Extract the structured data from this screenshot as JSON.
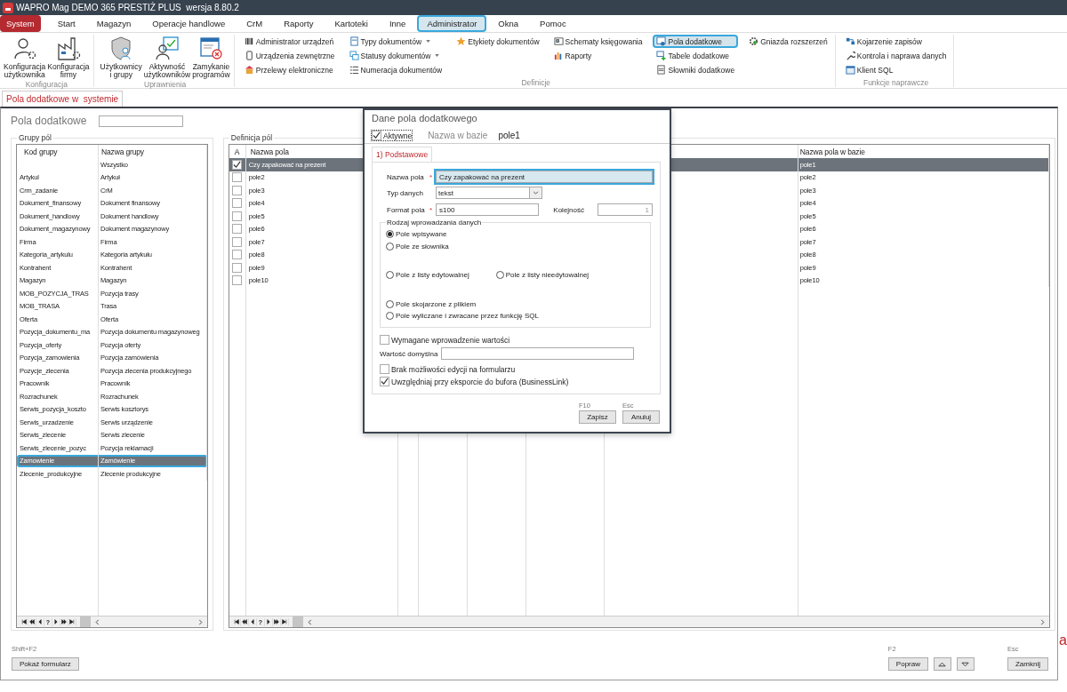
{
  "window": {
    "title": "WAPRO Mag DEMO 365 PRESTIŻ PLUS  wersja 8.80.2"
  },
  "menu_tabs": [
    {
      "label": "System",
      "kind": "app",
      "selected": false,
      "highlighted": false
    },
    {
      "label": "Start",
      "kind": "tab",
      "selected": false,
      "highlighted": false
    },
    {
      "label": "Magazyn",
      "kind": "tab",
      "selected": false,
      "highlighted": false
    },
    {
      "label": "Operacje handlowe",
      "kind": "tab",
      "selected": false,
      "highlighted": false
    },
    {
      "label": "CrM",
      "kind": "tab",
      "selected": false,
      "highlighted": false
    },
    {
      "label": "Raporty",
      "kind": "tab",
      "selected": false,
      "highlighted": false
    },
    {
      "label": "Kartoteki",
      "kind": "tab",
      "selected": false,
      "highlighted": false
    },
    {
      "label": "Inne",
      "kind": "tab",
      "selected": false,
      "highlighted": false
    },
    {
      "label": "Administrator",
      "kind": "tab",
      "selected": true,
      "highlighted": true
    },
    {
      "label": "Okna",
      "kind": "tab",
      "selected": false,
      "highlighted": false
    },
    {
      "label": "Pomoc",
      "kind": "tab",
      "selected": false,
      "highlighted": false
    }
  ],
  "ribbon": [
    {
      "label": "Konfiguracja",
      "kind": "large",
      "items": [
        {
          "label": "Konfiguracja\nużytkownika"
        },
        {
          "label": "Konfiguracja\nfirmy"
        }
      ]
    },
    {
      "label": "Uprawnienia",
      "kind": "large",
      "items": [
        {
          "label": "Użytkownicy\ni grupy"
        },
        {
          "label": "Aktywność\nużytkowników"
        },
        {
          "label": "Zamykanie\nprogramów"
        }
      ]
    },
    {
      "label": "Definicje",
      "kind": "small",
      "columns": [
        [
          {
            "label": "Administrator urządzeń",
            "has_menu": false,
            "highlighted": false
          },
          {
            "label": "Urządzenia zewnętrzne",
            "has_menu": false,
            "highlighted": false
          },
          {
            "label": "Przelewy elektroniczne",
            "has_menu": false,
            "highlighted": false
          }
        ],
        [
          {
            "label": "Typy dokumentów",
            "has_menu": true,
            "highlighted": false
          },
          {
            "label": "Statusy dokumentów",
            "has_menu": true,
            "highlighted": false
          },
          {
            "label": "Numeracja dokumentów",
            "has_menu": false,
            "highlighted": false
          }
        ],
        [
          {
            "label": "Etykiety dokumentów",
            "has_menu": false,
            "highlighted": false
          }
        ],
        [
          {
            "label": "Schematy księgowania",
            "has_menu": false,
            "highlighted": false
          },
          {
            "label": "Raporty",
            "has_menu": false,
            "highlighted": false
          }
        ],
        [
          {
            "label": "Pola dodatkowe",
            "has_menu": false,
            "highlighted": true
          },
          {
            "label": "Tabele dodatkowe",
            "has_menu": false,
            "highlighted": false
          },
          {
            "label": "Słowniki dodatkowe",
            "has_menu": false,
            "highlighted": false
          }
        ],
        [
          {
            "label": "Gniazda rozszerzeń",
            "has_menu": false,
            "highlighted": false
          }
        ]
      ]
    },
    {
      "label": "Funkcje naprawcze",
      "kind": "small",
      "columns": [
        [
          {
            "label": "Kojarzenie zapisów",
            "has_menu": false,
            "highlighted": false
          },
          {
            "label": "Kontrola i naprawa danych",
            "has_menu": false,
            "highlighted": false
          },
          {
            "label": "Klient SQL",
            "has_menu": false,
            "highlighted": false
          }
        ]
      ]
    }
  ],
  "document_tab": {
    "label": "Pola dodatkowe w  systemie"
  },
  "page_title": "Pola dodatkowe",
  "groups_panel": {
    "title": "Grupy pól",
    "columns": [
      "Kod grupy",
      "Nazwa grupy"
    ],
    "nav_help": "?",
    "rows": [
      {
        "name": "Wszystko",
        "selected": false,
        "highlighted": false
      },
      {
        "code": "Artykul",
        "name": "Artykuł",
        "selected": false,
        "highlighted": false
      },
      {
        "code": "Crm_zadanie",
        "name": "CrM",
        "selected": false,
        "highlighted": false
      },
      {
        "code": "Dokument_finansowy",
        "name": "Dokument finansowy",
        "selected": false,
        "highlighted": false
      },
      {
        "code": "Dokument_handlowy",
        "name": "Dokument handlowy",
        "selected": false,
        "highlighted": false
      },
      {
        "code": "Dokument_magazynowy",
        "name": "Dokument magazynowy",
        "selected": false,
        "highlighted": false
      },
      {
        "code": "Firma",
        "name": "Firma",
        "selected": false,
        "highlighted": false
      },
      {
        "code": "Kategoria_artykulu",
        "name": "Kategoria artykułu",
        "selected": false,
        "highlighted": false
      },
      {
        "code": "Kontrahent",
        "name": "Kontrahent",
        "selected": false,
        "highlighted": false
      },
      {
        "code": "Magazyn",
        "name": "Magazyn",
        "selected": false,
        "highlighted": false
      },
      {
        "code": "MOB_POZYCJA_TRAS",
        "name": "Pozycja trasy",
        "selected": false,
        "highlighted": false
      },
      {
        "code": "MOB_TRASA",
        "name": "Trasa",
        "selected": false,
        "highlighted": false
      },
      {
        "code": "Oferta",
        "name": "Oferta",
        "selected": false,
        "highlighted": false
      },
      {
        "code": "Pozycja_dokumentu_ma",
        "name": "Pozycja dokumentu magazynoweg",
        "selected": false,
        "highlighted": false
      },
      {
        "code": "Pozycja_oferty",
        "name": "Pozycja oferty",
        "selected": false,
        "highlighted": false
      },
      {
        "code": "Pozycja_zamowienia",
        "name": "Pozycja zamówienia",
        "selected": false,
        "highlighted": false
      },
      {
        "code": "Pozycje_zlecenia",
        "name": "Pozycja zlecenia produkcyjnego",
        "selected": false,
        "highlighted": false
      },
      {
        "code": "Pracownik",
        "name": "Pracownik",
        "selected": false,
        "highlighted": false
      },
      {
        "code": "Rozrachunek",
        "name": "Rozrachunek",
        "selected": false,
        "highlighted": false
      },
      {
        "code": "Serwis_pozycja_koszto",
        "name": "Serwis kosztorys",
        "selected": false,
        "highlighted": false
      },
      {
        "code": "Serwis_urzadzenie",
        "name": "Serwis urządzenie",
        "selected": false,
        "highlighted": false
      },
      {
        "code": "Serwis_zlecenie",
        "name": "Serwis zlecenie",
        "selected": false,
        "highlighted": false
      },
      {
        "code": "Serwis_zlecenie_pozyc",
        "name": "Pozycja reklamacji",
        "selected": false,
        "highlighted": false
      },
      {
        "code": "Zamowienie",
        "name": "Zamówienie",
        "selected": true,
        "highlighted": true
      },
      {
        "code": "Zlecenie_produkcyjne",
        "name": "Zlecenie produkcyjne",
        "selected": false,
        "highlighted": false
      }
    ]
  },
  "fields_panel": {
    "title": "Definicja pól",
    "columns": [
      "A",
      "Nazwa pola",
      "Nazwa pola w bazie"
    ],
    "nav_help": "?",
    "rows": [
      {
        "active": true,
        "name": "Czy zapakować na prezent",
        "db_name": "pole1",
        "selected": true
      },
      {
        "active": false,
        "name": "pole2",
        "db_name": "pole2",
        "selected": false
      },
      {
        "active": false,
        "name": "pole3",
        "db_name": "pole3",
        "selected": false
      },
      {
        "active": false,
        "name": "pole4",
        "db_name": "pole4",
        "selected": false
      },
      {
        "active": false,
        "name": "pole5",
        "db_name": "pole5",
        "selected": false
      },
      {
        "active": false,
        "name": "pole6",
        "db_name": "pole6",
        "selected": false
      },
      {
        "active": false,
        "name": "pole7",
        "db_name": "pole7",
        "selected": false
      },
      {
        "active": false,
        "name": "pole8",
        "db_name": "pole8",
        "selected": false
      },
      {
        "active": false,
        "name": "pole9",
        "db_name": "pole9",
        "selected": false
      },
      {
        "active": false,
        "name": "pole10",
        "db_name": "pole10",
        "selected": false
      }
    ]
  },
  "footer": {
    "show_form": {
      "shortcut": "Shift+F2",
      "label": "Pokaż formularz"
    },
    "edit": {
      "shortcut": "F2",
      "label": "Popraw"
    },
    "close": {
      "shortcut": "Esc",
      "label": "Zamknij"
    }
  },
  "edge_mark": "a",
  "dialog": {
    "title": "Dane pola dodatkowego",
    "active": {
      "label": "Aktywne",
      "checked": true
    },
    "db_name_label": "Nazwa w bazie",
    "db_name": "pole1",
    "tab": {
      "label": "1) Podstawowe",
      "selected": true
    },
    "name_field": {
      "label": "Nazwa pola",
      "value": "Czy zapakować na prezent",
      "required_mark": "*",
      "highlighted": true
    },
    "type_field": {
      "label": "Typ danych",
      "value": "tekst"
    },
    "format_field": {
      "label": "Format pola",
      "value": "s100",
      "required_mark": "*"
    },
    "order_field": {
      "label": "Kolejność",
      "value": "1",
      "disabled": true
    },
    "input_mode": {
      "title": "Rodzaj wprowadzania danych",
      "options": [
        {
          "label": "Pole wpisywane",
          "selected": true
        },
        {
          "label": "Pole ze słownika",
          "selected": false
        },
        {
          "label": "Pole z listy edytowalnej",
          "selected": false
        },
        {
          "label": "Pole z listy nieedytowalnej",
          "selected": false
        },
        {
          "label": "Pole skojarzone z plikiem",
          "selected": false
        },
        {
          "label": "Pole wyliczane i zwracane przez funkcję SQL",
          "selected": false
        }
      ]
    },
    "required_check": {
      "label": "Wymagane wprowadzenie wartości",
      "checked": false
    },
    "default_field": {
      "label": "Wartość domyślna"
    },
    "no_edit_check": {
      "label": "Brak możliwości edycji na formularzu",
      "checked": false
    },
    "export_check": {
      "label": "Uwzględniaj przy eksporcie do bufora (BusinessLink)",
      "checked": true
    },
    "buttons": [
      {
        "shortcut": "F10",
        "label": "Zapisz"
      },
      {
        "shortcut": "Esc",
        "label": "Anuluj"
      }
    ]
  }
}
